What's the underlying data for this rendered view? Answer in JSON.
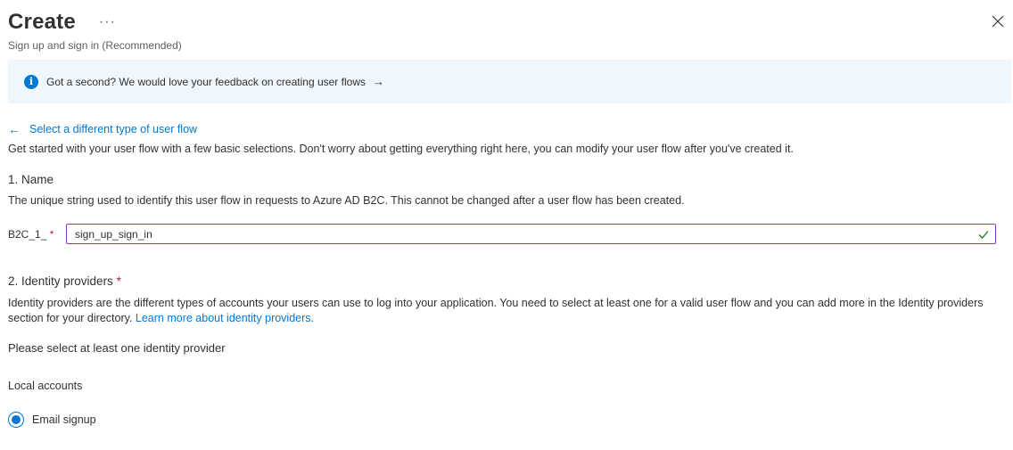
{
  "header": {
    "title": "Create",
    "more_label": "···",
    "subtitle": "Sign up and sign in (Recommended)"
  },
  "banner": {
    "icon": "info-icon",
    "text": "Got a second? We would love your feedback on creating user flows",
    "arrow": "→"
  },
  "nav": {
    "back_arrow": "←",
    "back_label": "Select a different type of user flow"
  },
  "intro": "Get started with your user flow with a few basic selections. Don't worry about getting everything right here, you can modify your user flow after you've created it.",
  "name_section": {
    "heading": "1. Name",
    "description": "The unique string used to identify this user flow in requests to Azure AD B2C. This cannot be changed after a user flow has been created.",
    "prefix": "B2C_1_",
    "required_mark": "*",
    "value": "sign_up_sign_in"
  },
  "idp_section": {
    "heading": "2. Identity providers",
    "required_mark": "*",
    "description": "Identity providers are the different types of accounts your users can use to log into your application. You need to select at least one for a valid user flow and you can add more in the Identity providers section for your directory.",
    "link_text": "Learn more about identity providers.",
    "prompt": "Please select at least one identity provider",
    "group_label": "Local accounts",
    "option_label": "Email signup",
    "option_selected": true
  },
  "colors": {
    "accent": "#0078d4",
    "banner_bg": "#eff6fc",
    "input_border": "#8a3ab9",
    "valid": "#107c10",
    "required": "#a4262c"
  }
}
